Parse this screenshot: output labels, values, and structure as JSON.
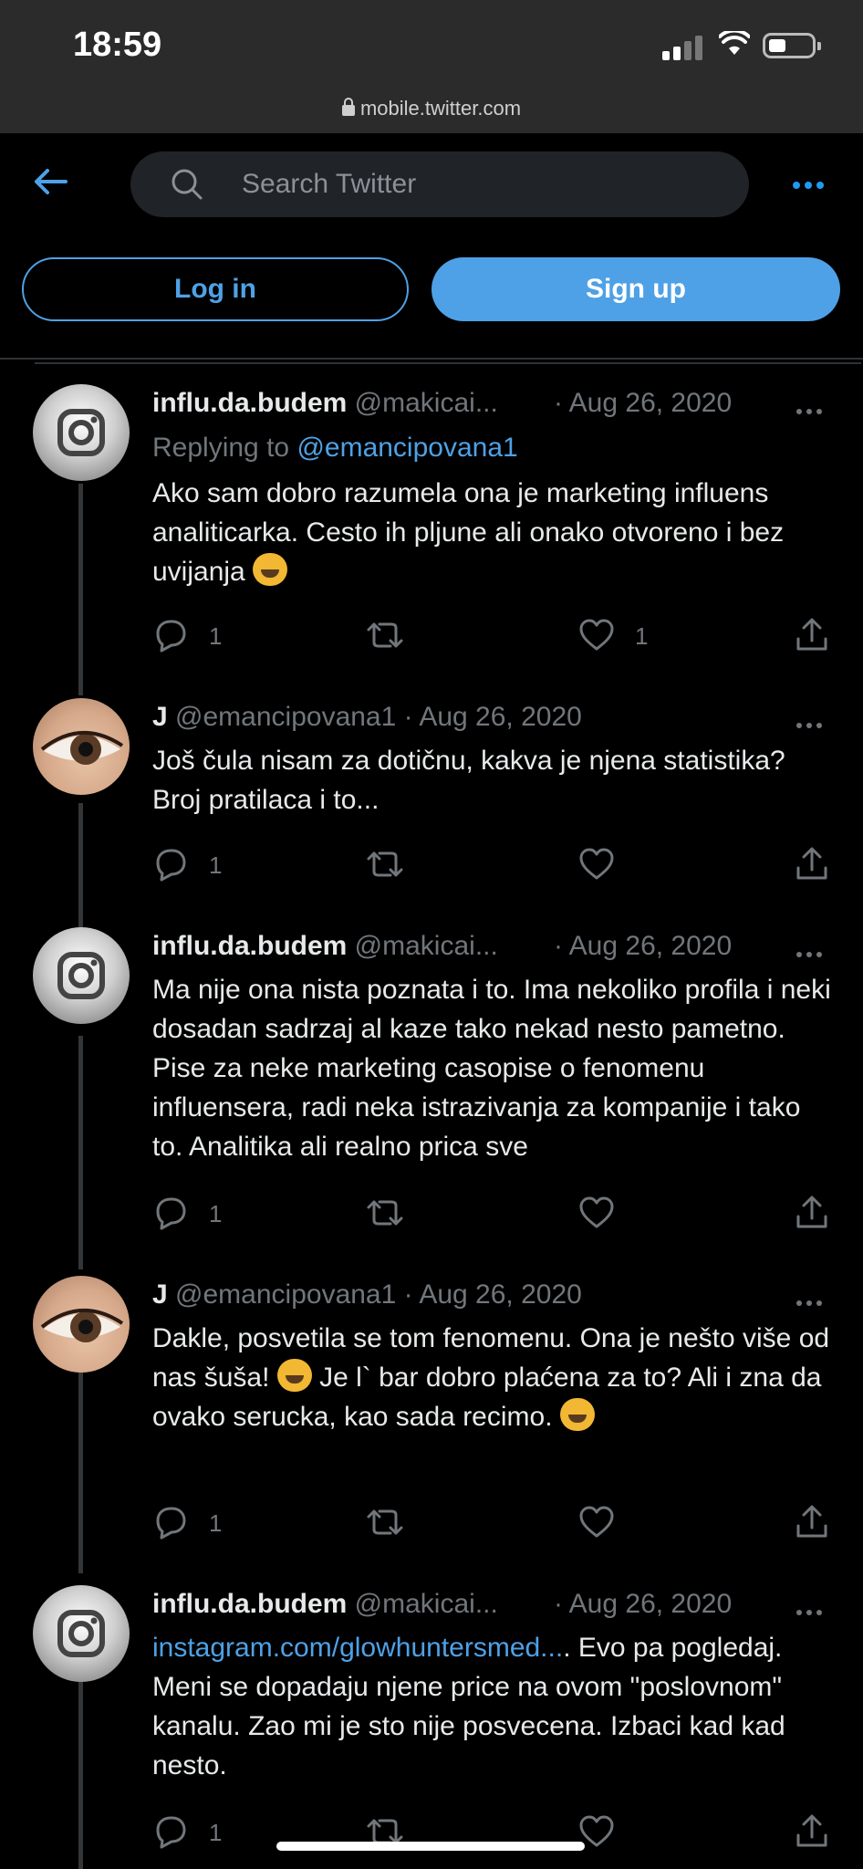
{
  "status_bar": {
    "time": "18:59"
  },
  "browser": {
    "url": "mobile.twitter.com"
  },
  "header": {
    "search_placeholder": "Search Twitter",
    "login_label": "Log in",
    "signup_label": "Sign up"
  },
  "colors": {
    "accent": "#4ea1e6",
    "background": "#000000",
    "secondary_text": "#71767b"
  },
  "tweets": [
    {
      "name": "influ.da.budem",
      "handle": "@makicai...",
      "date": "· Aug 26, 2020",
      "replying_label": "Replying to",
      "replying_to": "@emancipovana1",
      "text": "Ako sam dobro razumela ona je marketing influens analiticarka. Cesto ih pljune ali onako otvoreno i bez uvijanja",
      "emoji": "😹",
      "replies": "1",
      "likes": "1",
      "avatar": "instagram-logo"
    },
    {
      "name": "J",
      "handle": "@emancipovana1",
      "date": "· Aug 26, 2020",
      "text": "Još čula nisam za dotičnu, kakva je njena statistika? Broj pratilaca i to...",
      "replies": "1",
      "avatar": "eye-photo"
    },
    {
      "name": "influ.da.budem",
      "handle": "@makicai...",
      "date": "· Aug 26, 2020",
      "text": "Ma nije ona nista poznata i to. Ima nekoliko profila i neki dosadan sadrzaj al kaze tako nekad nesto pametno. Pise za neke marketing casopise o fenomenu influensera, radi neka istrazivanja za kompanije i tako to. Analitika ali realno prica sve",
      "replies": "1",
      "avatar": "instagram-logo"
    },
    {
      "name": "J",
      "handle": "@emancipovana1",
      "date": "· Aug 26, 2020",
      "text_a": "Dakle, posvetila se tom fenomenu. Ona je nešto više od nas šuša!",
      "text_b": "Je l` bar dobro plaćena za to? Ali i zna da ovako serucka, kao sada recimo.",
      "emoji": "🤣",
      "replies": "1",
      "avatar": "eye-photo"
    },
    {
      "name": "influ.da.budem",
      "handle": "@makicai...",
      "date": "· Aug 26, 2020",
      "link": "instagram.com/glowhuntersmed...",
      "text": ". Evo pa pogledaj. Meni se dopadaju njene price na ovom \"poslovnom\" kanalu. Zao mi je sto nije posvecena. Izbaci kad kad nesto.",
      "replies": "1",
      "avatar": "instagram-logo"
    }
  ]
}
